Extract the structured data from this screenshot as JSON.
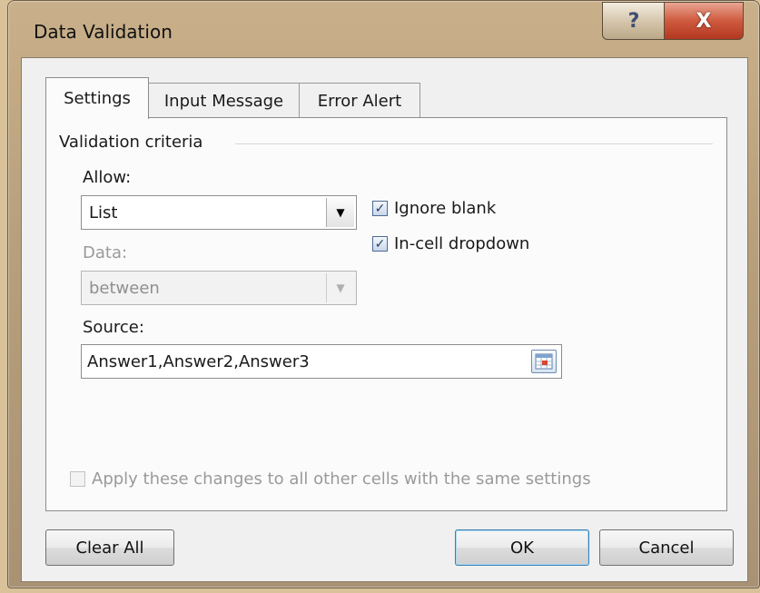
{
  "window": {
    "title": "Data Validation"
  },
  "titlebar": {
    "help_glyph": "?",
    "close_glyph": "X"
  },
  "tabs": [
    {
      "label": "Settings",
      "active": true
    },
    {
      "label": "Input Message",
      "active": false
    },
    {
      "label": "Error Alert",
      "active": false
    }
  ],
  "settings": {
    "group_title": "Validation criteria",
    "allow_label": "Allow:",
    "allow_value": "List",
    "data_label": "Data:",
    "data_value": "between",
    "ignore_blank_label": "Ignore blank",
    "ignore_blank_checked": true,
    "incell_dropdown_label": "In-cell dropdown",
    "incell_dropdown_checked": true,
    "source_label": "Source:",
    "source_value": "Answer1,Answer2,Answer3",
    "apply_all_label": "Apply these changes to all other cells with the same settings",
    "apply_all_checked": false
  },
  "footer": {
    "clear_all_label": "Clear All",
    "ok_label": "OK",
    "cancel_label": "Cancel"
  },
  "icons": {
    "help": "question-mark-icon",
    "close": "close-icon",
    "dropdown": "chevron-down-icon",
    "checkbox": "checkmark-icon",
    "range_ref": "collapse-dialog-icon"
  }
}
